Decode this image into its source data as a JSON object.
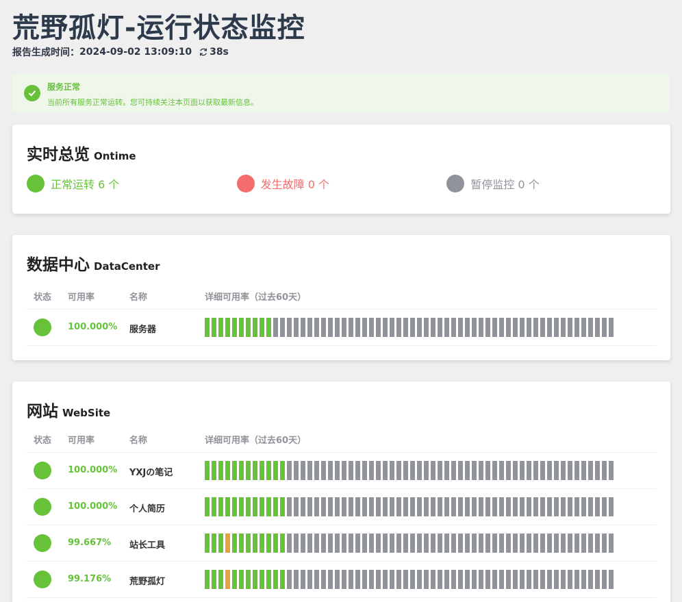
{
  "page": {
    "title": "荒野孤灯-运行状态监控",
    "report_label": "报告生成时间：",
    "report_time": "2024-09-02 13:09:10",
    "refresh_countdown": "38s"
  },
  "alert": {
    "title": "服务正常",
    "description": "当前所有服务正常运转。您可持续关注本页面以获取最新信息。"
  },
  "overview": {
    "title": "实时总览",
    "title_en": "Ontime",
    "items": [
      {
        "label": "正常运转 6 个",
        "color": "#67c23a"
      },
      {
        "label": "发生故障 0 个",
        "color": "#f56c6c"
      },
      {
        "label": "暂停监控 0 个",
        "color": "#909399"
      }
    ]
  },
  "table_headers": {
    "status": "状态",
    "rate": "可用率",
    "name": "名称",
    "detail": "详细可用率（过去60天）"
  },
  "datacenter": {
    "title": "数据中心",
    "title_en": "DataCenter",
    "rows": [
      {
        "rate": "100.000%",
        "name": "服务器",
        "bars": [
          "ok",
          "ok",
          "ok",
          "ok",
          "ok",
          "ok",
          "ok",
          "ok",
          "ok",
          "ok"
        ]
      }
    ]
  },
  "website": {
    "title": "网站",
    "title_en": "WebSite",
    "rows": [
      {
        "rate": "100.000%",
        "name": "YXJの笔记",
        "bars": [
          "ok",
          "ok",
          "ok",
          "ok",
          "ok",
          "ok",
          "ok",
          "ok",
          "ok",
          "ok",
          "ok",
          "ok"
        ]
      },
      {
        "rate": "100.000%",
        "name": "个人简历",
        "bars": [
          "ok",
          "ok",
          "ok",
          "ok",
          "ok",
          "ok",
          "ok",
          "ok",
          "ok",
          "ok",
          "ok",
          "ok"
        ]
      },
      {
        "rate": "99.667%",
        "name": "站长工具",
        "bars": [
          "ok",
          "ok",
          "ok",
          "warn",
          "ok",
          "ok",
          "ok",
          "ok",
          "ok",
          "ok",
          "ok",
          "ok"
        ]
      },
      {
        "rate": "99.176%",
        "name": "荒野孤灯",
        "bars": [
          "ok",
          "ok",
          "ok",
          "warn",
          "ok",
          "ok",
          "ok",
          "ok",
          "ok",
          "ok",
          "ok",
          "ok"
        ]
      }
    ]
  },
  "colors": {
    "ok": "#67c23a",
    "warn": "#e6a23c",
    "down": "#f56c6c",
    "nodata": "#909399"
  }
}
